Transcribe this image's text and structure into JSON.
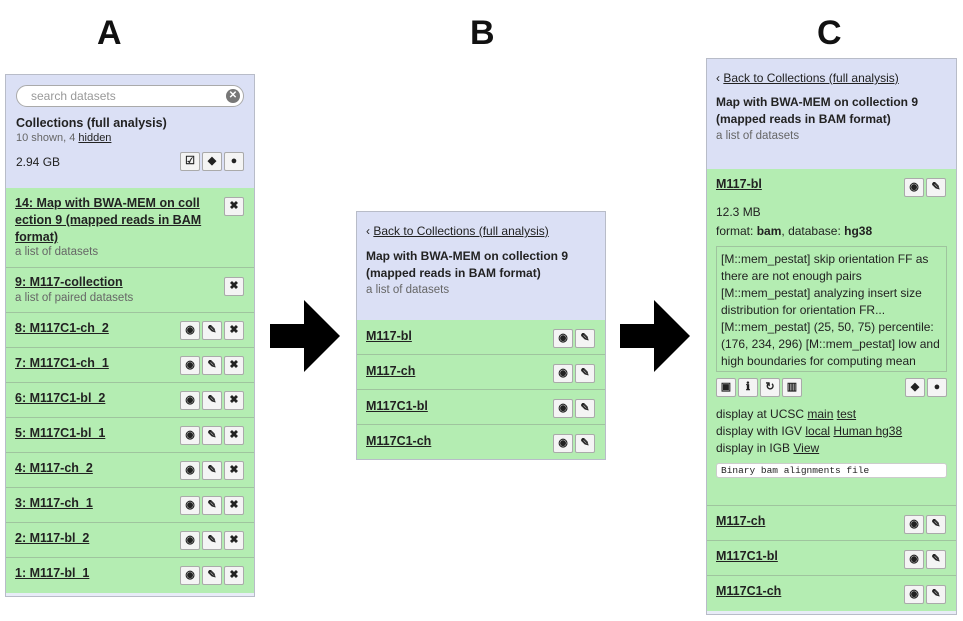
{
  "letters": {
    "a": "A",
    "b": "B",
    "c": "C"
  },
  "panelA": {
    "search_placeholder": "search datasets",
    "title": "Collections (full analysis)",
    "shown": "10 shown, 4",
    "hidden_link": "hidden",
    "size": "2.94 GB",
    "items": [
      {
        "label": "14: Map with BWA-MEM on coll ection 9 (mapped reads in BAM format)",
        "sub": "a list of datasets"
      },
      {
        "label": "9: M117-collection",
        "sub": "a list of paired datasets"
      },
      {
        "label": "8: M117C1-ch_2"
      },
      {
        "label": "7: M117C1-ch_1"
      },
      {
        "label": "6: M117C1-bl_2"
      },
      {
        "label": "5: M117C1-bl_1"
      },
      {
        "label": "4: M117-ch_2"
      },
      {
        "label": "3: M117-ch_1"
      },
      {
        "label": "2: M117-bl_2"
      },
      {
        "label": "1: M117-bl_1"
      }
    ]
  },
  "panelB": {
    "back": "Back to Collections (full analysis)",
    "title": "Map with BWA-MEM on collection 9 (mapped reads in BAM format)",
    "sub": "a list of datasets",
    "items": [
      {
        "label": "M117-bl"
      },
      {
        "label": "M117-ch"
      },
      {
        "label": "M117C1-bl"
      },
      {
        "label": "M117C1-ch"
      }
    ]
  },
  "panelC": {
    "back": "Back to Collections (full analysis)",
    "title": "Map with BWA-MEM on collection 9 (mapped reads in BAM format)",
    "sub": "a list of datasets",
    "expanded": {
      "label": "M117-bl",
      "size": "12.3 MB",
      "format_label": "format:",
      "format": "bam",
      "database_label": "database:",
      "database": "hg38",
      "info": "[M::mem_pestat] skip orientation FF as there are not enough pairs [M::mem_pestat] analyzing insert size distribution for orientation FR... [M::mem_pestat] (25, 50, 75) percentile: (176, 234, 296) [M::mem_pestat] low and high boundaries for computing mean",
      "ucsc_prefix": "display at UCSC",
      "ucsc_main": "main",
      "ucsc_test": "test",
      "igv_prefix": "display with IGV",
      "igv_local": "local",
      "igv_human": "Human hg38",
      "igb_prefix": "display in IGB",
      "igb_view": "View",
      "peek": "Binary bam alignments file"
    },
    "items": [
      {
        "label": "M117-ch"
      },
      {
        "label": "M117C1-bl"
      },
      {
        "label": "M117C1-ch"
      }
    ]
  }
}
